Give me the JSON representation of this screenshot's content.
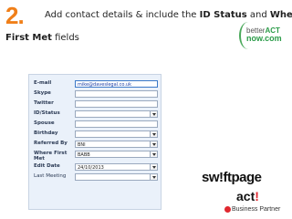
{
  "slide": {
    "step_number": "2.",
    "headline_part1": "Add contact details & include the ",
    "headline_bold1": "ID Status",
    "headline_part2": " and ",
    "headline_bold2": "Where",
    "headline_line2_bold": "First Met",
    "headline_line2_rest": " fields"
  },
  "branding": {
    "better_act_line1_a": "better",
    "better_act_line1_b": "ACT",
    "better_act_line2": "now.com",
    "swiftpage": "sw!ftpage",
    "act_main": "act",
    "act_mark": "!",
    "partner": "Business Partner"
  },
  "form": {
    "rows": [
      {
        "label": "E-mail",
        "value": "mike@daveslegal.co.uk",
        "dropdown": false
      },
      {
        "label": "Skype",
        "value": "",
        "dropdown": false
      },
      {
        "label": "Twitter",
        "value": "",
        "dropdown": false
      },
      {
        "label": "ID/Status",
        "value": "",
        "dropdown": true
      },
      {
        "label": "Spouse",
        "value": "",
        "dropdown": false
      },
      {
        "label": "Birthday",
        "value": "",
        "dropdown": true
      },
      {
        "label": "Referred By",
        "value": "BNI",
        "dropdown": true
      },
      {
        "label": "Where First Met",
        "value": "BABB",
        "dropdown": true
      },
      {
        "label": "Edit Date",
        "value": "24/10/2013",
        "dropdown": true
      },
      {
        "label": "Last Meeting",
        "value": "",
        "dropdown": true
      }
    ]
  },
  "colors": {
    "accent_orange": "#f07f19",
    "panel_bg": "#eaf1fa",
    "brand_green": "#2a9b48",
    "act_red": "#e0282f"
  }
}
